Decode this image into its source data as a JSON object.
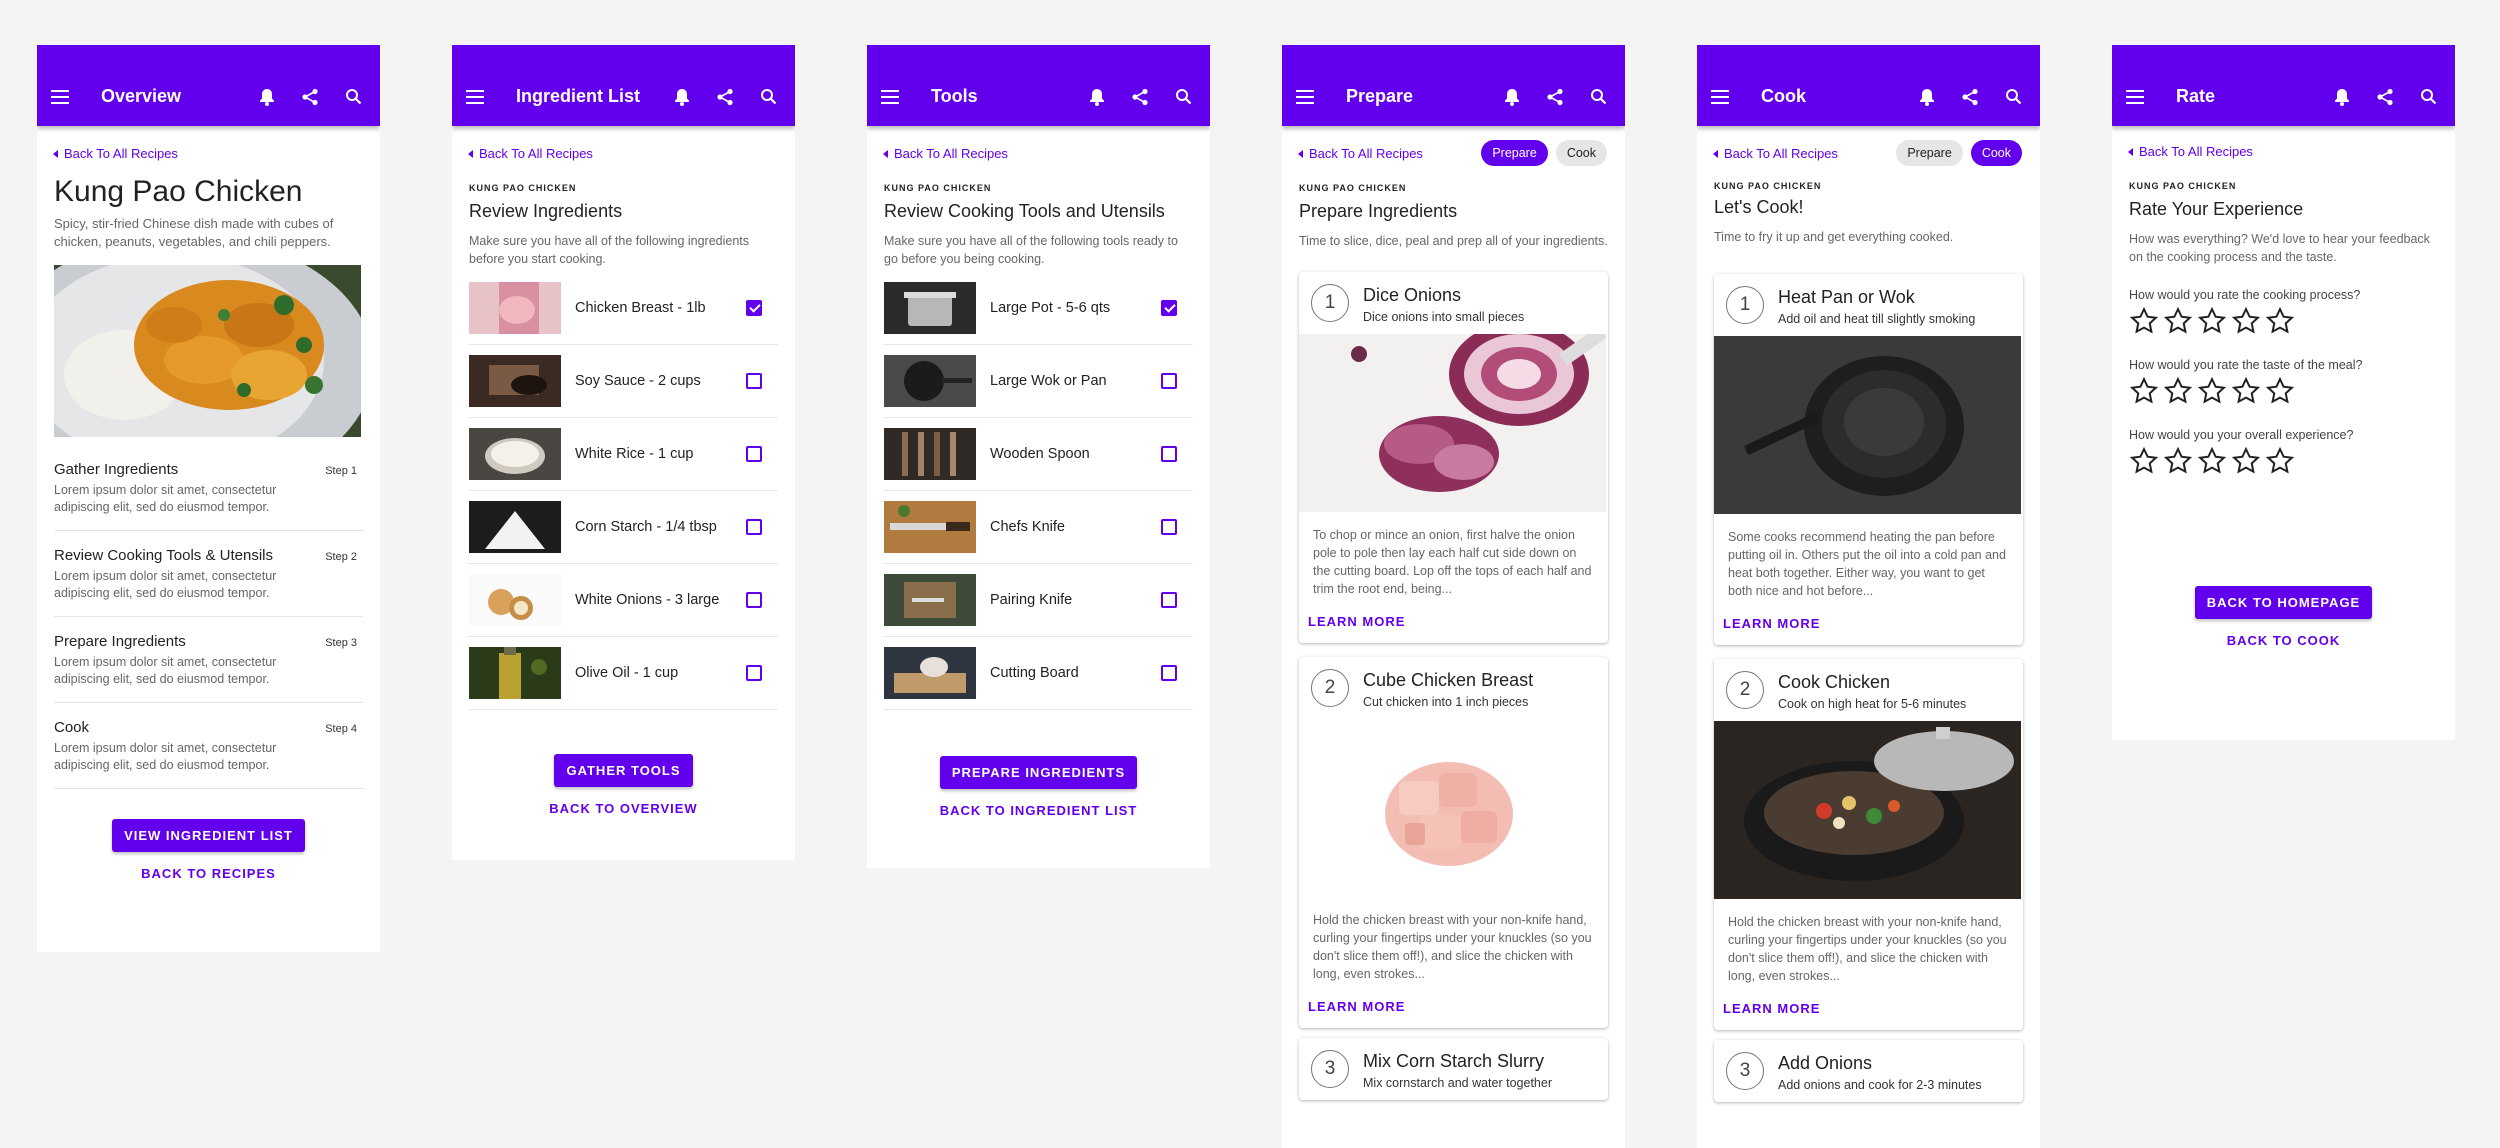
{
  "colors": {
    "primary": "#6200ee",
    "background": "#f4f4f4"
  },
  "common": {
    "back_link": "Back To All Recipes",
    "overline": "KUNG PAO CHICKEN",
    "icons": [
      "menu-icon",
      "bell-icon",
      "share-icon",
      "search-icon"
    ],
    "learn_more": "LEARN MORE",
    "chip_prepare": "Prepare",
    "chip_cook": "Cook"
  },
  "overview": {
    "title": "Overview",
    "recipe_title": "Kung Pao Chicken",
    "description": "Spicy, stir-fried Chinese dish made with cubes of chicken, peanuts, vegetables, and chili peppers.",
    "steps": [
      {
        "title": "Gather Ingredients",
        "desc": "Lorem ipsum dolor sit amet, consectetur adipiscing elit, sed do eiusmod tempor.",
        "step": "Step 1"
      },
      {
        "title": "Review Cooking Tools & Utensils",
        "desc": "Lorem ipsum dolor sit amet, consectetur adipiscing elit, sed do eiusmod tempor.",
        "step": "Step 2"
      },
      {
        "title": "Prepare Ingredients",
        "desc": "Lorem ipsum dolor sit amet, consectetur adipiscing elit, sed do eiusmod tempor.",
        "step": "Step 3"
      },
      {
        "title": "Cook",
        "desc": "Lorem ipsum dolor sit amet, consectetur adipiscing elit, sed do eiusmod tempor.",
        "step": "Step 4"
      }
    ],
    "primary_button": "VIEW INGREDIENT LIST",
    "text_button": "BACK TO RECIPES"
  },
  "ingredients": {
    "title": "Ingredient List",
    "heading": "Review Ingredients",
    "desc": "Make sure you have all of the following ingredients before you start cooking.",
    "items": [
      {
        "label": "Chicken Breast - 1lb",
        "checked": true
      },
      {
        "label": "Soy Sauce - 2 cups",
        "checked": false
      },
      {
        "label": "White Rice - 1 cup",
        "checked": false
      },
      {
        "label": "Corn Starch - 1/4 tbsp",
        "checked": false
      },
      {
        "label": "White Onions - 3 large",
        "checked": false
      },
      {
        "label": "Olive Oil - 1 cup",
        "checked": false
      }
    ],
    "primary_button": "GATHER TOOLS",
    "text_button": "BACK TO OVERVIEW"
  },
  "tools": {
    "title": "Tools",
    "heading": "Review Cooking Tools and Utensils",
    "desc": "Make sure you have all of the following tools ready to go before you being cooking.",
    "items": [
      {
        "label": "Large Pot - 5-6 qts",
        "checked": true
      },
      {
        "label": "Large Wok or Pan",
        "checked": false
      },
      {
        "label": "Wooden Spoon",
        "checked": false
      },
      {
        "label": "Chefs Knife",
        "checked": false
      },
      {
        "label": "Pairing Knife",
        "checked": false
      },
      {
        "label": "Cutting Board",
        "checked": false
      }
    ],
    "primary_button": "PREPARE INGREDIENTS",
    "text_button": "BACK TO INGREDIENT LIST"
  },
  "prepare": {
    "title": "Prepare",
    "heading": "Prepare Ingredients",
    "desc": "Time to slice, dice, peal and prep all of your ingredients.",
    "cards": [
      {
        "num": "1",
        "title": "Dice Onions",
        "sub": "Dice onions into small pieces",
        "body": "To chop or mince an onion, first halve the onion pole to pole then lay each half cut side down on the cutting board. Lop off the tops of each half and trim the root end, being..."
      },
      {
        "num": "2",
        "title": "Cube Chicken Breast",
        "sub": "Cut chicken into 1 inch pieces",
        "body": "Hold the chicken breast with your non-knife hand, curling your fingertips under your knuckles (so you don't slice them off!), and slice the chicken with long, even strokes..."
      },
      {
        "num": "3",
        "title": "Mix Corn Starch Slurry",
        "sub": "Mix cornstarch and water together"
      }
    ]
  },
  "cook": {
    "title": "Cook",
    "heading": "Let's Cook!",
    "desc": "Time to fry it up and get everything cooked.",
    "cards": [
      {
        "num": "1",
        "title": "Heat Pan or Wok",
        "sub": "Add oil and heat till slightly smoking",
        "body": "Some cooks recommend heating the pan before putting oil in. Others put the oil into a cold pan and heat both together. Either way, you want to get both nice and hot before..."
      },
      {
        "num": "2",
        "title": "Cook Chicken",
        "sub": "Cook on high heat for 5-6 minutes",
        "body": "Hold the chicken breast with your non-knife hand, curling your fingertips under your knuckles (so you don't slice them off!), and slice the chicken with long, even strokes..."
      },
      {
        "num": "3",
        "title": "Add Onions",
        "sub": "Add onions and cook for 2-3 minutes"
      }
    ]
  },
  "rate": {
    "title": "Rate",
    "heading": "Rate Your Experience",
    "desc": "How was everything? We'd love to hear your feedback on the cooking process and the taste.",
    "questions": [
      {
        "q": "How would you rate the cooking process?",
        "stars": 0
      },
      {
        "q": "How would you rate the taste of the meal?",
        "stars": 0
      },
      {
        "q": "How would you your overall experience?",
        "stars": 0
      }
    ],
    "primary_button": "BACK TO HOMEPAGE",
    "text_button": "BACK TO COOK"
  }
}
